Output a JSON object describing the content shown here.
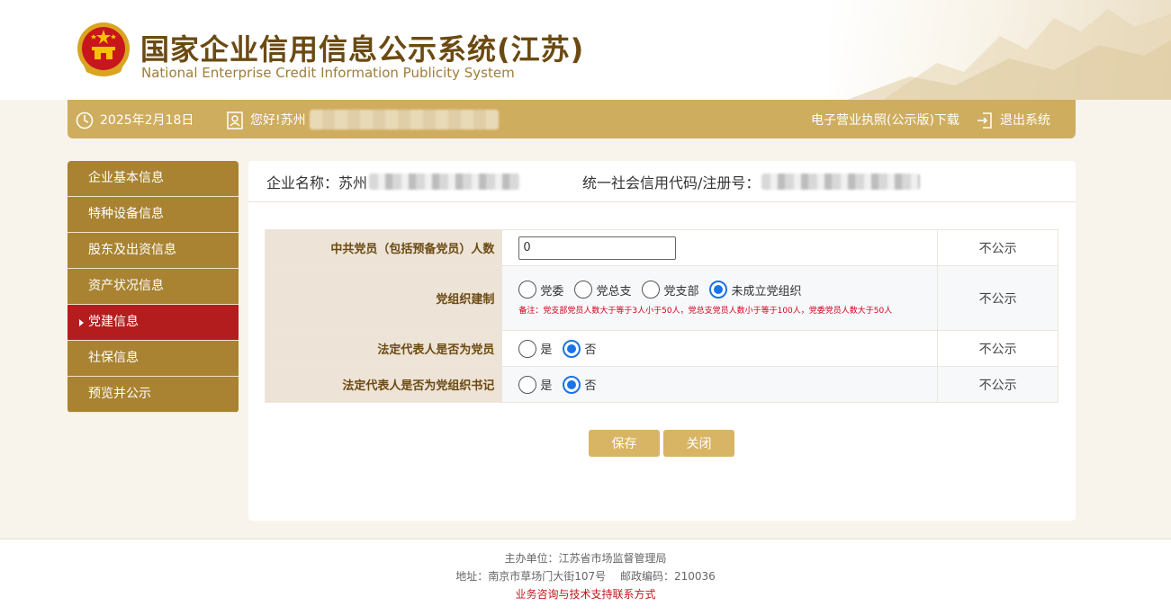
{
  "header": {
    "title_cn": "国家企业信用信息公示系统(江苏)",
    "title_en": "National Enterprise Credit Information Publicity System"
  },
  "topbar": {
    "date": "2025年2月18日",
    "greeting": "您好!苏州",
    "license_download": "电子营业执照(公示版)下载",
    "logout": "退出系统"
  },
  "sidebar": {
    "items": [
      {
        "label": "企业基本信息"
      },
      {
        "label": "特种设备信息"
      },
      {
        "label": "股东及出资信息"
      },
      {
        "label": "资产状况信息"
      },
      {
        "label": "党建信息",
        "active": true
      },
      {
        "label": "社保信息"
      },
      {
        "label": "预览并公示"
      }
    ]
  },
  "company": {
    "name_label": "企业名称：苏州",
    "code_label": "统一社会信用代码/注册号："
  },
  "form": {
    "rows": [
      {
        "label": "中共党员（包括预备党员）人数",
        "value": "0",
        "publicity": "不公示"
      },
      {
        "label": "党组织建制",
        "options": [
          "党委",
          "党总支",
          "党支部",
          "未成立党组织"
        ],
        "selected": "未成立党组织",
        "note": "备注：党支部党员人数大于等于3人小于50人，党总支党员人数小于等于100人，党委党员人数大于50人",
        "publicity": "不公示"
      },
      {
        "label": "法定代表人是否为党员",
        "options": [
          "是",
          "否"
        ],
        "selected": "否",
        "publicity": "不公示"
      },
      {
        "label": "法定代表人是否为党组织书记",
        "options": [
          "是",
          "否"
        ],
        "selected": "否",
        "publicity": "不公示"
      }
    ]
  },
  "buttons": {
    "save": "保存",
    "close": "关闭"
  },
  "footer": {
    "organizer": "主办单位：江苏省市场监督管理局",
    "address": "地址：南京市草场门大街107号　 邮政编码：210036",
    "support_link": "业务咨询与技术支持联系方式"
  },
  "colors": {
    "brand_gold": "#cfad5f",
    "sidebar_gold": "#a98332",
    "active_red": "#b41d1d",
    "radio_blue": "#1a73e8"
  }
}
